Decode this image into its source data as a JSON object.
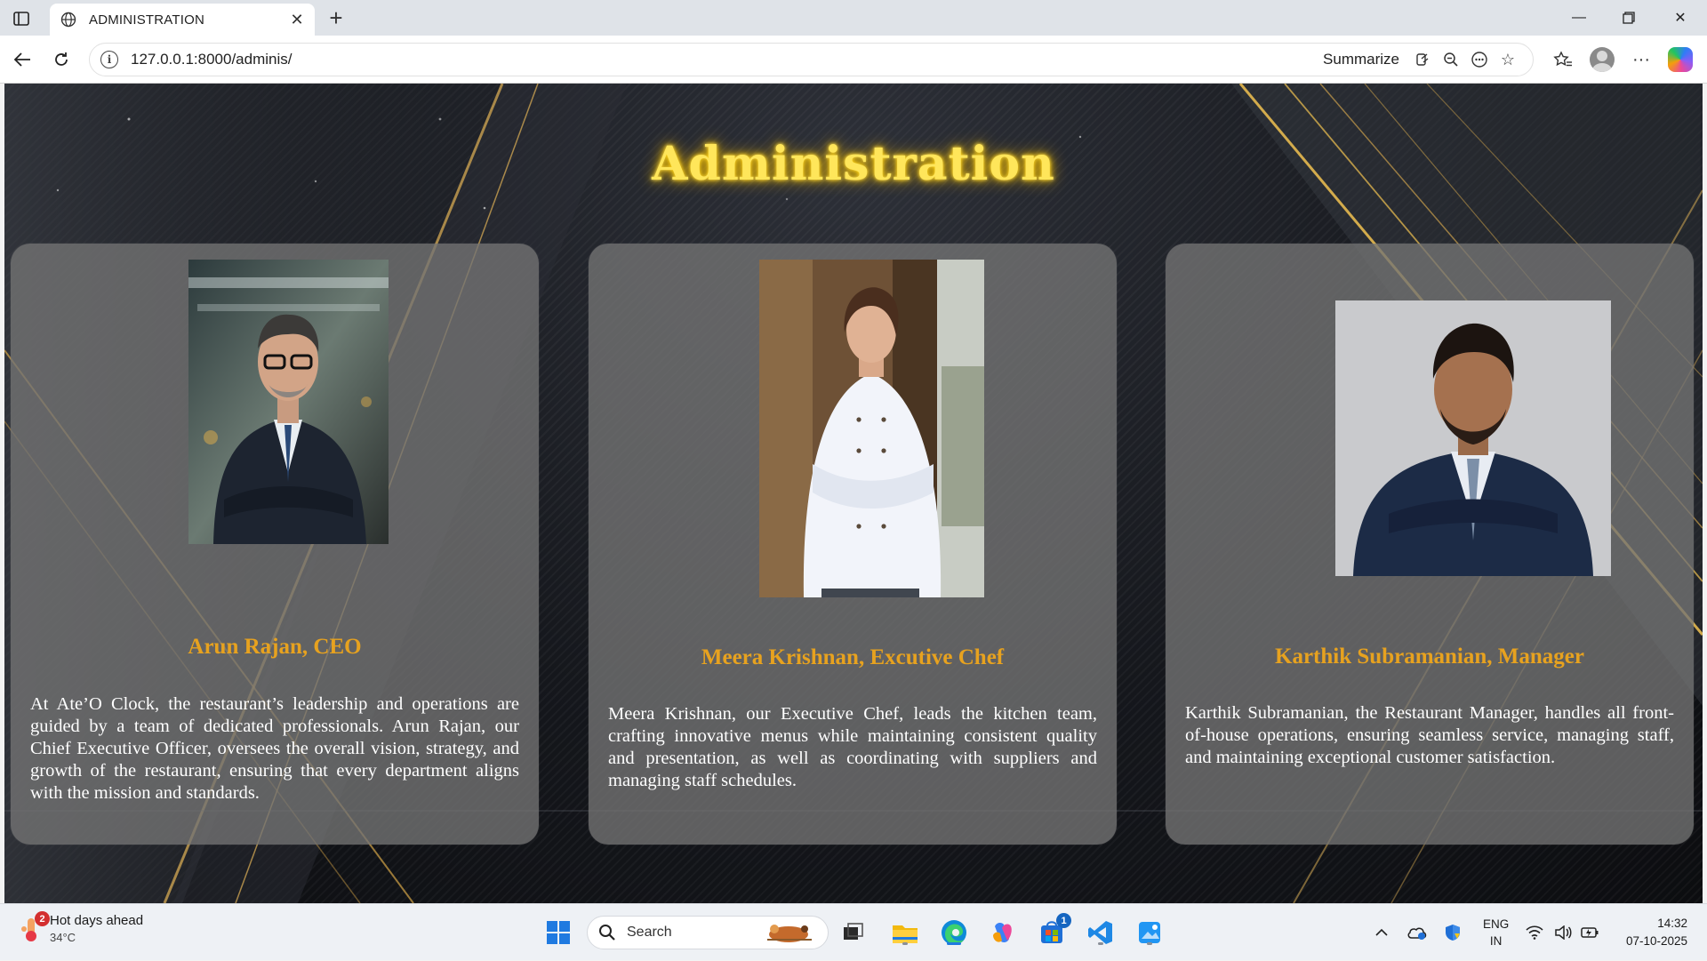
{
  "browser": {
    "tab_title": "ADMINISTRATION",
    "url": "127.0.0.1:8000/adminis/",
    "summarize_label": "Summarize"
  },
  "page": {
    "title": "Administration",
    "cards": [
      {
        "name": "Arun Rajan, CEO",
        "description": "At Ate’O Clock, the restaurant’s leadership and operations are guided by a team of dedicated professionals. Arun Rajan, our Chief Executive Officer, oversees the overall vision, strategy, and growth of the restaurant, ensuring that every department aligns with the mission and standards."
      },
      {
        "name": "Meera Krishnan, Excutive Chef",
        "description": "Meera Krishnan, our Executive Chef, leads the kitchen team, crafting innovative menus while maintaining consistent quality and presentation, as well as coordinating with suppliers and managing staff schedules."
      },
      {
        "name": "Karthik Subramanian, Manager",
        "description": "Karthik Subramanian, the Restaurant Manager, handles all front-of-house operations, ensuring seamless service, managing staff, and maintaining exceptional customer satisfaction."
      }
    ]
  },
  "taskbar": {
    "weather_title": "Hot days ahead",
    "weather_temp": "34°C",
    "weather_badge": "2",
    "search_label": "Search",
    "store_badge": "1",
    "lang_top": "ENG",
    "lang_bottom": "IN",
    "time": "14:32",
    "date": "07-10-2025"
  },
  "colors": {
    "title_glow": "#ffe65a",
    "name_gold": "#e7a21f",
    "card_bg": "#747474"
  }
}
